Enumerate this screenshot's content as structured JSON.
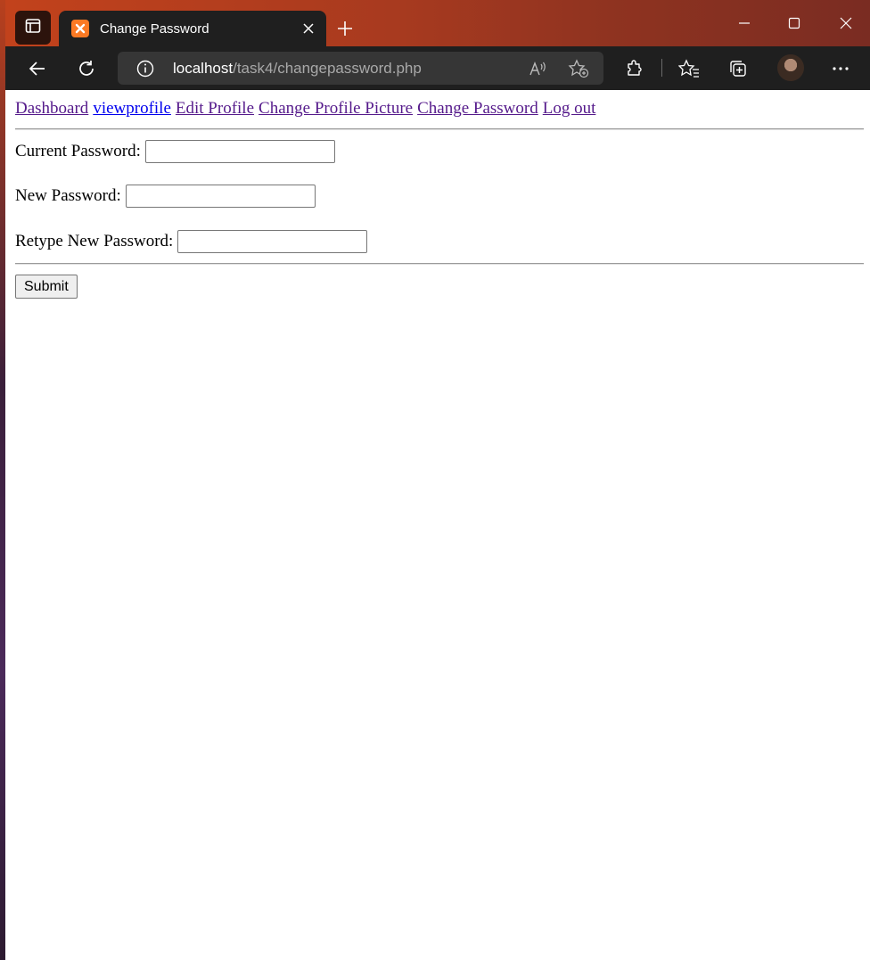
{
  "browser": {
    "tab_title": "Change Password",
    "url_host": "localhost",
    "url_path": "/task4/changepassword.php",
    "titlebar_color": "#c2421c",
    "favicon_color": "#fb7a24"
  },
  "nav": {
    "links": [
      {
        "label": "Dashboard",
        "visited": true
      },
      {
        "label": "viewprofile",
        "visited": false
      },
      {
        "label": "Edit Profile",
        "visited": true
      },
      {
        "label": "Change Profile Picture",
        "visited": true
      },
      {
        "label": "Change Password",
        "visited": true
      },
      {
        "label": "Log out",
        "visited": true
      }
    ]
  },
  "form": {
    "current_password_label": "Current Password:",
    "current_password_value": "",
    "new_password_label": "New Password:",
    "new_password_value": "",
    "retype_password_label": "Retype New Password:",
    "retype_password_value": "",
    "submit_label": "Submit"
  }
}
